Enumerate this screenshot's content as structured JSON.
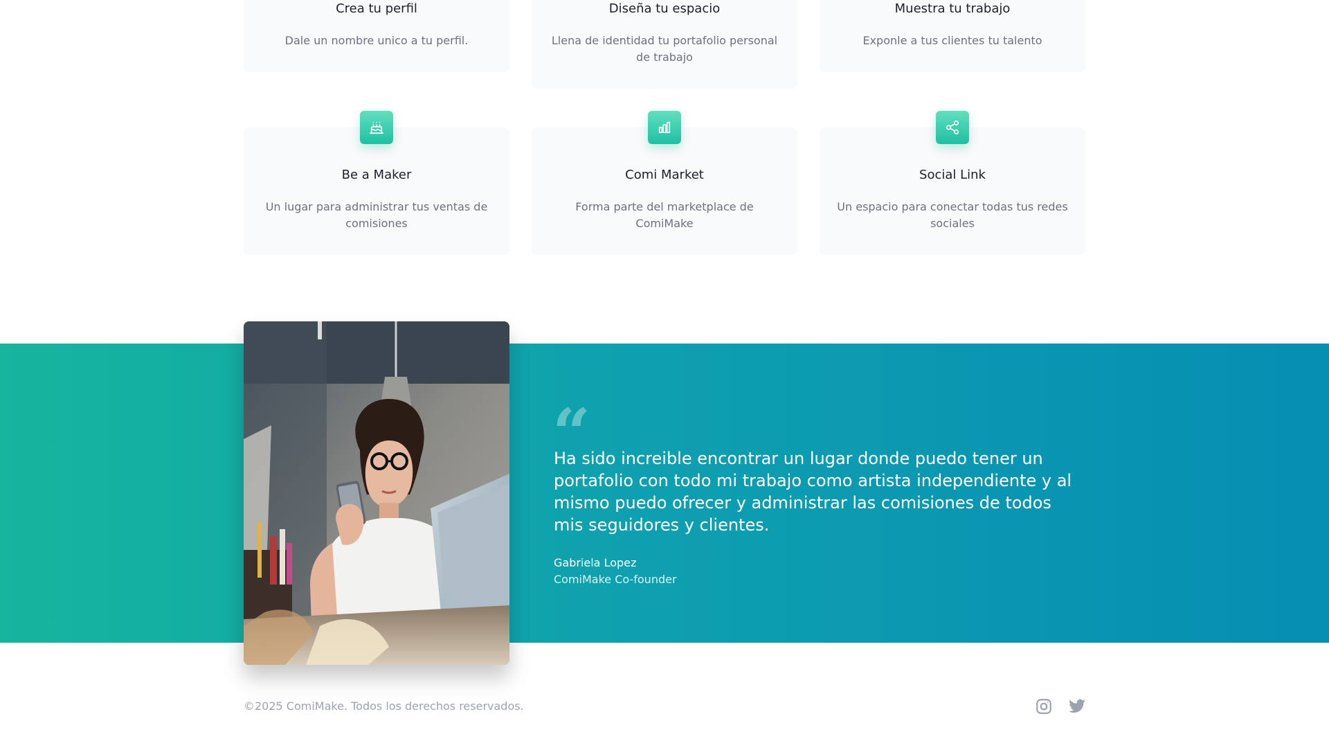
{
  "features_top": [
    {
      "title": "Crea tu perfil",
      "description": "Dale un nombre unico a tu perfil."
    },
    {
      "title": "Diseña tu espacio",
      "description": "Llena de identidad tu portafolio personal de trabajo"
    },
    {
      "title": "Muestra tu trabajo",
      "description": "Exponle a tus clientes tu talento"
    }
  ],
  "features_bottom": [
    {
      "icon": "cake-icon",
      "title": "Be a Maker",
      "description": "Un lugar para administrar tus ventas de comisiones"
    },
    {
      "icon": "bar-chart-icon",
      "title": "Comi Market",
      "description": "Forma parte del marketplace de ComiMake"
    },
    {
      "icon": "share-icon",
      "title": "Social Link",
      "description": "Un espacio para conectar todas tus redes sociales"
    }
  ],
  "testimonial": {
    "quote_mark": "“",
    "text": "Ha sido increible encontrar un lugar donde puedo tener un portafolio con todo mi trabajo como artista independiente y al mismo puedo ofrecer y administrar las comisiones de todos mis seguidores y clientes.",
    "author": "Gabriela Lopez",
    "role": "ComiMake Co-founder"
  },
  "footer": {
    "copyright": "©2025 ComiMake. Todos los derechos reservados.",
    "social_icons": [
      "instagram-icon",
      "twitter-icon"
    ]
  },
  "colors": {
    "band_start": "#16b59e",
    "band_end": "#068eb3",
    "icon_accent": "#1fbfa3",
    "muted_text": "#6b7280"
  }
}
